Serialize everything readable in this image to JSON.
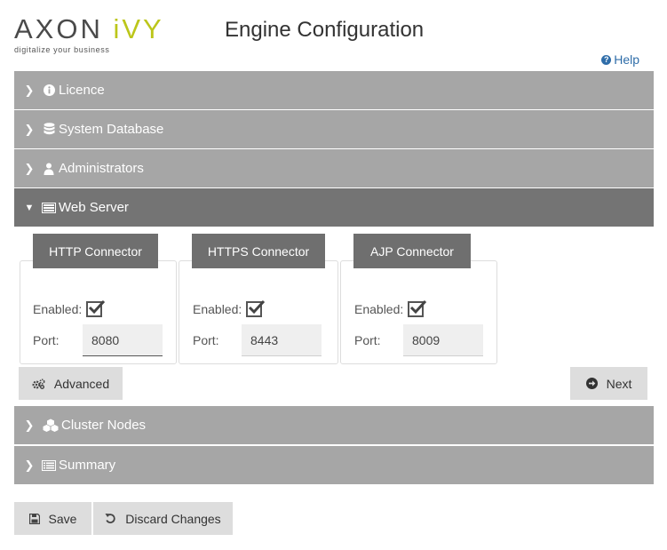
{
  "brand": {
    "name_main": "AXON ",
    "name_accent": "iVY",
    "tagline": "digitalize your business"
  },
  "page": {
    "title": "Engine Configuration",
    "help_label": "Help"
  },
  "sections": [
    {
      "label": "Licence",
      "icon": "info-icon",
      "expanded": false
    },
    {
      "label": "System Database",
      "icon": "database-icon",
      "expanded": false
    },
    {
      "label": "Administrators",
      "icon": "user-icon",
      "expanded": false
    },
    {
      "label": "Web Server",
      "icon": "server-icon",
      "expanded": true
    },
    {
      "label": "Cluster Nodes",
      "icon": "cubes-icon",
      "expanded": false
    },
    {
      "label": "Summary",
      "icon": "list-icon",
      "expanded": false
    }
  ],
  "web_server": {
    "connectors": [
      {
        "tab_label": "HTTP Connector",
        "enabled_label": "Enabled:",
        "enabled": true,
        "port_label": "Port:",
        "port_value": "8080"
      },
      {
        "tab_label": "HTTPS Connector",
        "enabled_label": "Enabled:",
        "enabled": true,
        "port_label": "Port:",
        "port_value": "8443"
      },
      {
        "tab_label": "AJP Connector",
        "enabled_label": "Enabled:",
        "enabled": true,
        "port_label": "Port:",
        "port_value": "8009"
      }
    ],
    "advanced_label": "Advanced",
    "next_label": "Next"
  },
  "footer": {
    "save_label": "Save",
    "discard_label": "Discard Changes"
  },
  "colors": {
    "accordion": "#a6a6a6",
    "accordion_open": "#747474",
    "tab": "#6f6f6f",
    "accent": "#bcc61a",
    "link": "#2f6da9"
  }
}
